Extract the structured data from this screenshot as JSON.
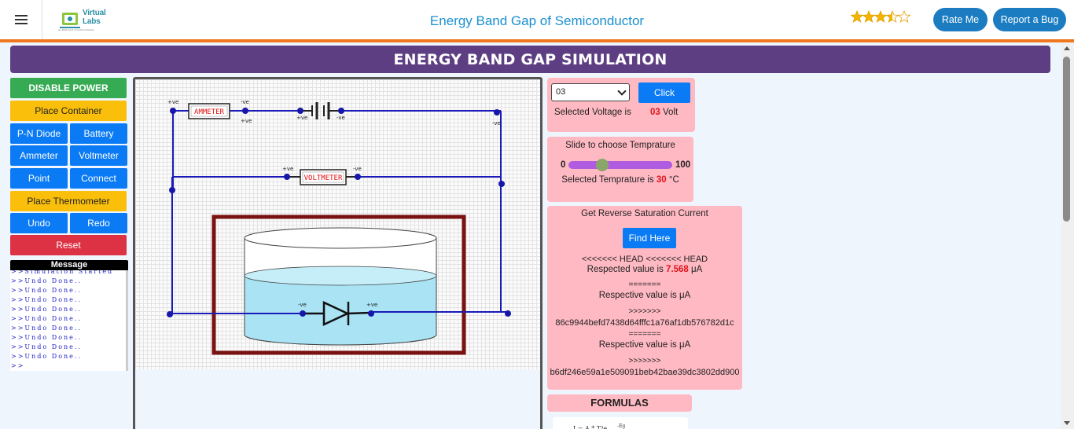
{
  "header": {
    "logo_text": "Virtual Labs",
    "logo_tagline": "An MoE Govt of India Initiative",
    "title": "Energy Band Gap of Semiconductor",
    "rating_stars": "★★★⯪☆",
    "rating_value": 3.5,
    "rate_me": "Rate Me",
    "report_bug": "Report a Bug"
  },
  "banner": "ENERGY BAND GAP SIMULATION",
  "controls": {
    "disable_power": "DISABLE POWER",
    "place_container": "Place Container",
    "pn_diode": "P-N Diode",
    "battery": "Battery",
    "ammeter": "Ammeter",
    "voltmeter": "Voltmeter",
    "point": "Point",
    "connect": "Connect",
    "place_thermometer": "Place Thermometer",
    "undo": "Undo",
    "redo": "Redo",
    "reset": "Reset"
  },
  "message": {
    "title": "Message",
    "lines": [
      ">>Simulation Started",
      ">>Undo Done..",
      ">>Undo Done..",
      ">>Undo Done..",
      ">>Undo Done..",
      ">>Undo Done..",
      ">>Undo Done..",
      ">>Undo Done..",
      ">>Undo Done..",
      ">>Undo Done..",
      ">>"
    ]
  },
  "circuit": {
    "ammeter_label": "AMMETER",
    "voltmeter_label": "VOLTMETER",
    "plus": "+ve",
    "minus": "-ve"
  },
  "voltage_panel": {
    "selected": "03",
    "click": "Click",
    "selected_label": "Selected Voltage is",
    "value": "03",
    "unit": "Volt"
  },
  "temp_panel": {
    "title": "Slide to choose Temprature",
    "min": "0",
    "max": "100",
    "slider_value": 30,
    "selected_label": "Selected Temprature is",
    "value": "30",
    "unit": "°C"
  },
  "current_panel": {
    "title": "Get Reverse Saturation Current",
    "find": "Find Here",
    "head_marker": "<<<<<<< HEAD <<<<<<< HEAD",
    "respected_label": "Respected value is",
    "respected_value": "7.568",
    "unit": "μA",
    "separator": "=======",
    "respective_label": "Respective value is",
    "arrows": ">>>>>>>",
    "hash1": "86c9944befd7438d64fffc1a76af1db576782d1c",
    "hash2": "b6df246e59a1e509091beb42bae39dc3802dd900"
  },
  "formulas": {
    "title": "FORMULAS"
  }
}
